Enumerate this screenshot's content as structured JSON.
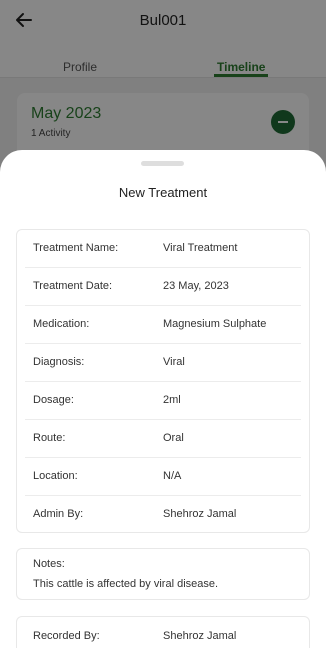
{
  "app": {
    "title": "Bul001",
    "tabs": {
      "profile": "Profile",
      "timeline": "Timeline"
    },
    "month_group": {
      "title": "May 2023",
      "subtitle": "1 Activity"
    },
    "colors": {
      "accent": "#2e7d32",
      "button": "#1f6b35"
    }
  },
  "sheet": {
    "title": "New Treatment",
    "details": [
      {
        "label": "Treatment Name:",
        "value": "Viral Treatment"
      },
      {
        "label": "Treatment Date:",
        "value": "23 May, 2023"
      },
      {
        "label": "Medication:",
        "value": "Magnesium Sulphate"
      },
      {
        "label": "Diagnosis:",
        "value": "Viral"
      },
      {
        "label": "Dosage:",
        "value": "2ml"
      },
      {
        "label": "Route:",
        "value": "Oral"
      },
      {
        "label": "Location:",
        "value": "N/A"
      },
      {
        "label": "Admin By:",
        "value": "Shehroz Jamal"
      }
    ],
    "notes": {
      "label": "Notes:",
      "text": "This cattle is affected by viral disease."
    },
    "recorded": {
      "label": "Recorded By:",
      "value": "Shehroz Jamal"
    }
  }
}
